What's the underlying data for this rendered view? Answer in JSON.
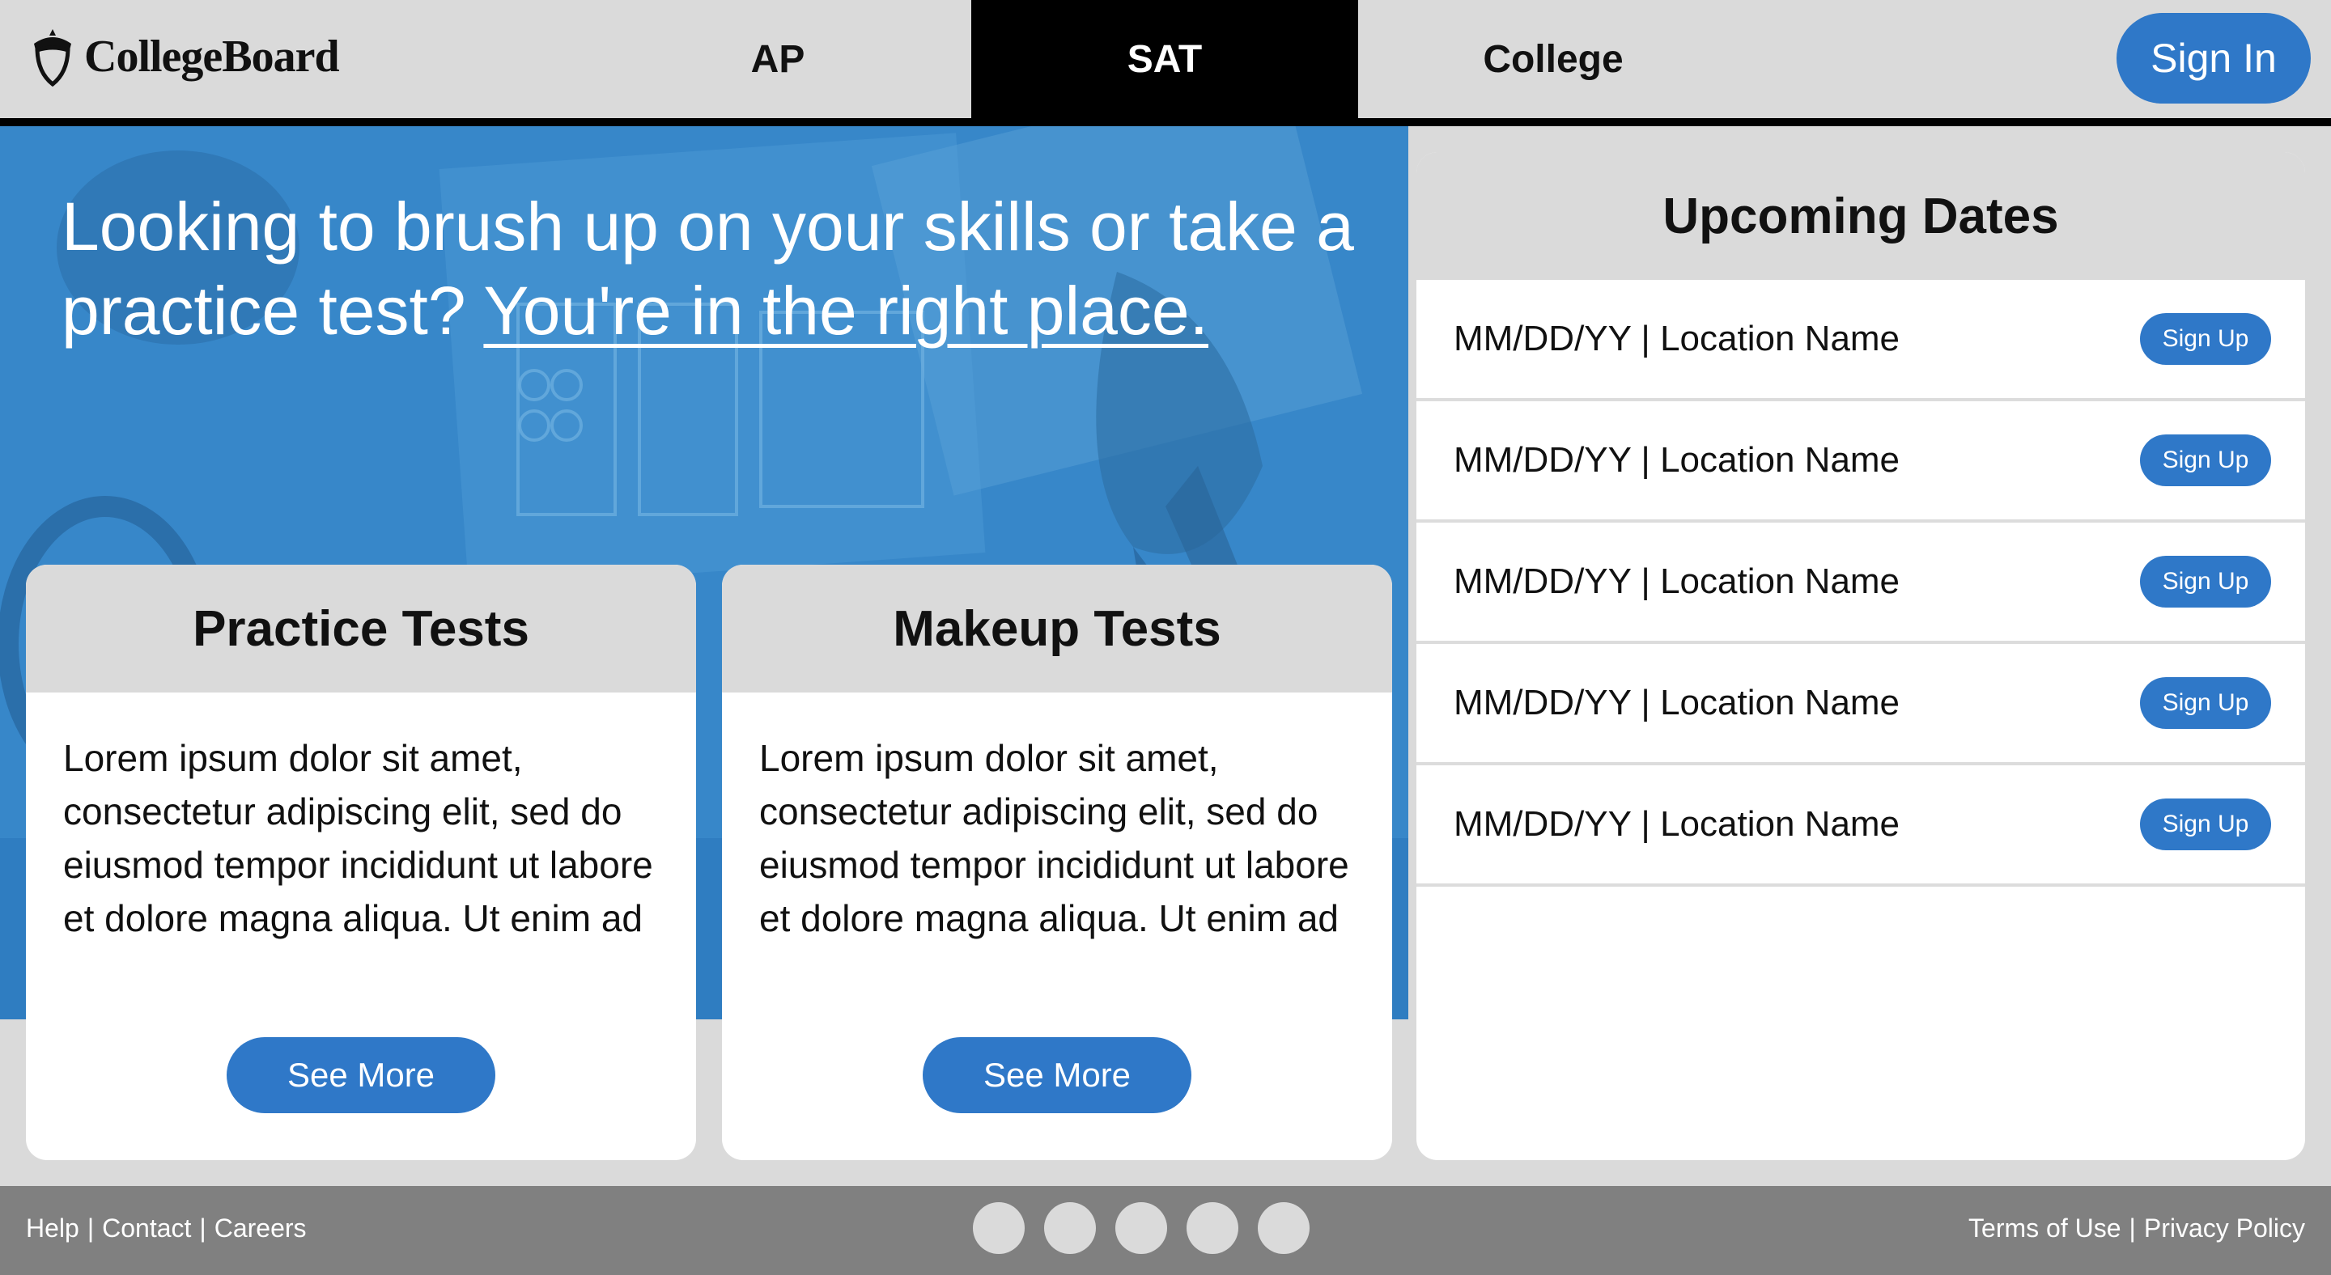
{
  "header": {
    "logo_text": "CollegeBoard",
    "nav": [
      {
        "label": "AP",
        "active": false
      },
      {
        "label": "SAT",
        "active": true
      },
      {
        "label": "College",
        "active": false
      }
    ],
    "signin_label": "Sign In"
  },
  "hero": {
    "headline_text": "Looking to brush up on your skills or take a practice test?",
    "headline_link": "You're in the right place."
  },
  "cards": [
    {
      "title": "Practice Tests",
      "body": "Lorem ipsum dolor sit amet, consectetur adipiscing elit, sed do eiusmod tempor incididunt ut labore et dolore magna aliqua. Ut enim ad",
      "button_label": "See More"
    },
    {
      "title": "Makeup Tests",
      "body": "Lorem ipsum dolor sit amet, consectetur adipiscing elit, sed do eiusmod tempor incididunt ut labore et dolore magna aliqua. Ut enim ad",
      "button_label": "See More"
    }
  ],
  "upcoming": {
    "title": "Upcoming Dates",
    "rows": [
      {
        "text": "MM/DD/YY | Location Name",
        "button_label": "Sign Up"
      },
      {
        "text": "MM/DD/YY | Location Name",
        "button_label": "Sign Up"
      },
      {
        "text": "MM/DD/YY | Location Name",
        "button_label": "Sign Up"
      },
      {
        "text": "MM/DD/YY | Location Name",
        "button_label": "Sign Up"
      },
      {
        "text": "MM/DD/YY | Location Name",
        "button_label": "Sign Up"
      }
    ]
  },
  "footer": {
    "left_links": [
      "Help",
      "Contact",
      "Careers"
    ],
    "right_links": [
      "Terms of Use",
      "Privacy Policy"
    ],
    "separator": "|",
    "carousel_dots": 5
  },
  "colors": {
    "accent": "#2f78c8",
    "header_bg": "#dadada",
    "footer_bg": "#808080",
    "hero_tint": "#2f7fc3"
  },
  "icons": {
    "logo": "acorn-icon"
  }
}
